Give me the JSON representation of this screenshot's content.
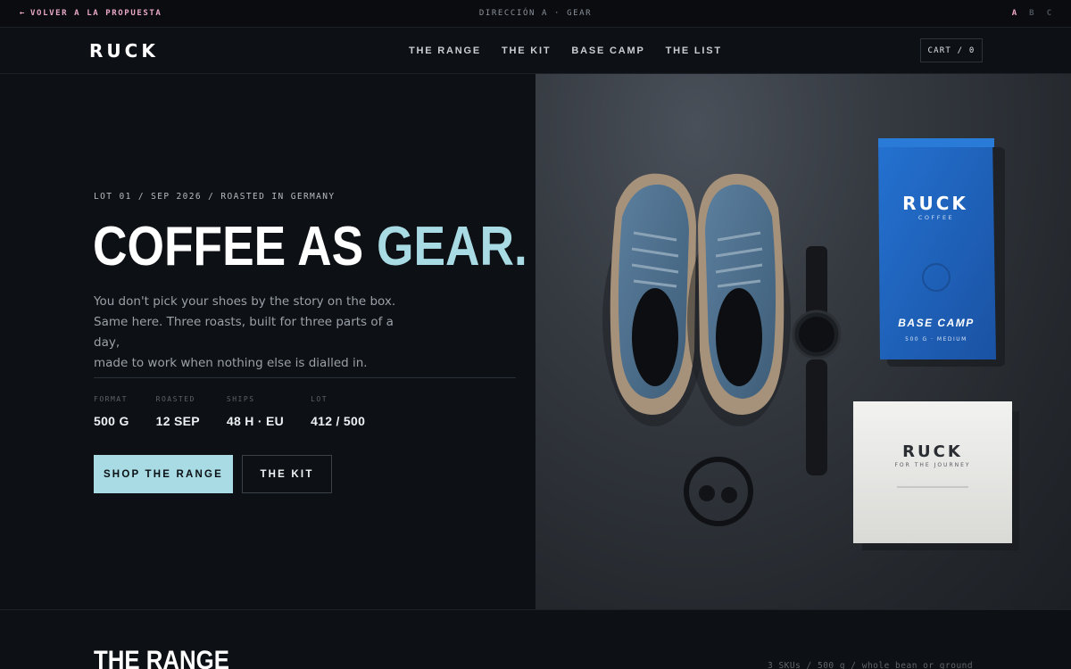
{
  "topbar": {
    "back_arrow": "←",
    "back_label": "VOLVER A LA PROPUESTA",
    "direction": "DIRECCIÓN A · GEAR",
    "variants": [
      "A",
      "B",
      "C"
    ],
    "active_variant": "A"
  },
  "nav": {
    "logo": "RUCK",
    "links": [
      "THE RANGE",
      "THE KIT",
      "BASE CAMP",
      "THE LIST"
    ],
    "cart": "CART / 0"
  },
  "hero": {
    "meta": "LOT 01 / SEP 2026 / ROASTED IN GERMANY",
    "headline_main": "COFFEE AS ",
    "headline_accent": "GEAR.",
    "body_lines": [
      "You don't pick your shoes by the story on the box.",
      "Same here. Three roasts, built for three parts of a day,",
      "made to work when nothing else is dialled in."
    ],
    "specs": [
      {
        "label": "FORMAT",
        "value": "500 G"
      },
      {
        "label": "ROASTED",
        "value": "12 SEP"
      },
      {
        "label": "SHIPS",
        "value": "48 H · EU"
      },
      {
        "label": "LOT",
        "value": "412 / 500"
      }
    ],
    "cta_primary": "SHOP THE RANGE",
    "cta_secondary": "THE KIT"
  },
  "product_image": {
    "bag_brand": "RUCK",
    "bag_sub": "COFFEE",
    "bag_name": "BASE CAMP",
    "bag_spec": "500 G · MEDIUM",
    "card_brand": "RUCK",
    "card_sub": "FOR THE JOURNEY"
  },
  "range": {
    "title": "THE RANGE",
    "meta": "3 SKUs / 500 g / whole bean or ground"
  },
  "colors": {
    "accent": "#a8dbe4",
    "back_link": "#e7a7c6",
    "background": "#0d1014",
    "bag_blue": "#1d5fb8"
  }
}
